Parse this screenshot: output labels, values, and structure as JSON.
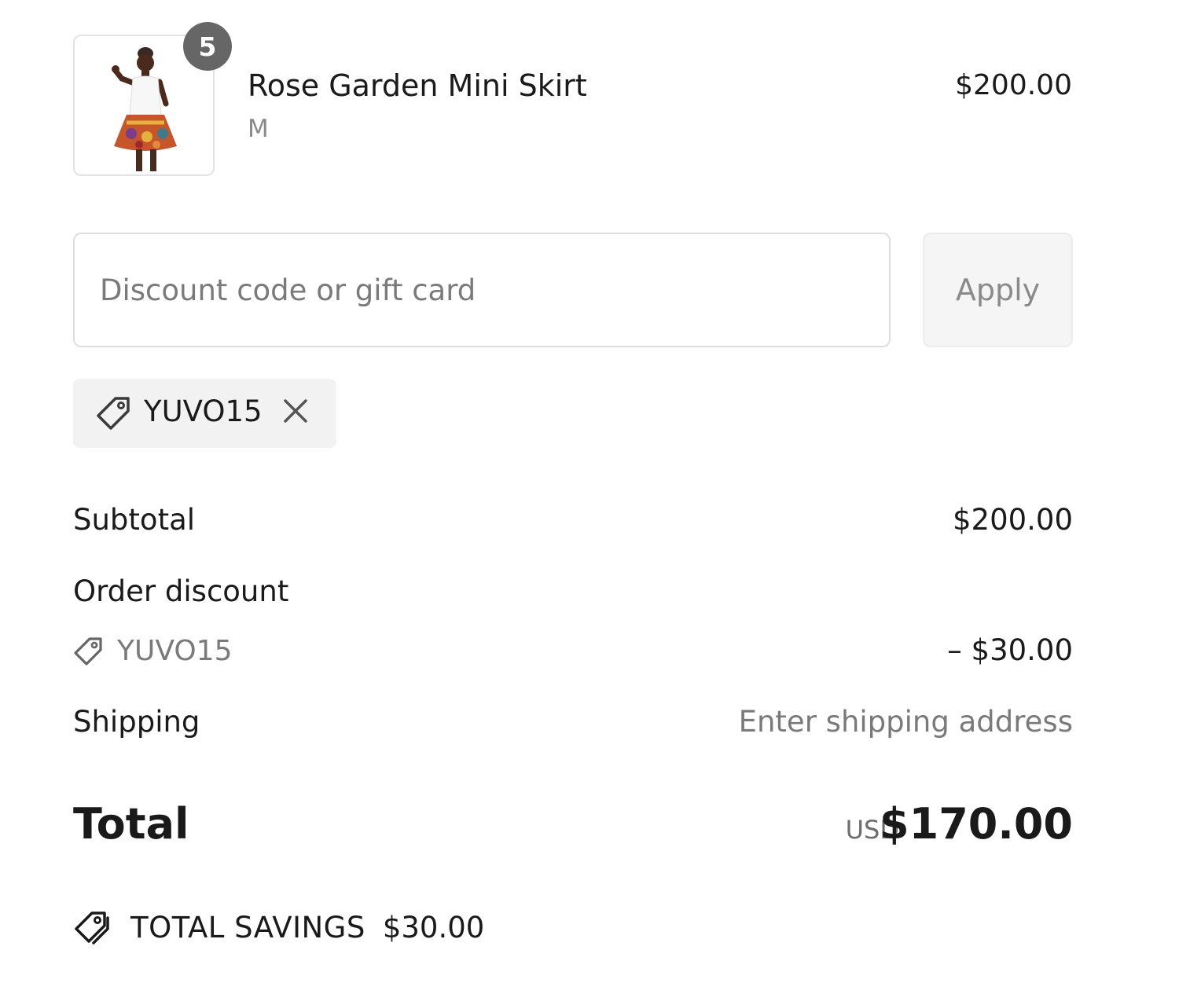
{
  "product": {
    "title": "Rose Garden Mini Skirt",
    "variant": "M",
    "price": "$200.00",
    "quantity": "5",
    "image_icon": "product-photo"
  },
  "discount": {
    "placeholder": "Discount code or gift card",
    "value": "",
    "apply_label": "Apply",
    "applied_code": "YUVO15"
  },
  "summary": {
    "subtotal_label": "Subtotal",
    "subtotal_value": "$200.00",
    "order_discount_label": "Order discount",
    "order_discount_code": "YUVO15",
    "order_discount_value": "– $30.00",
    "shipping_label": "Shipping",
    "shipping_value": "Enter shipping address"
  },
  "total": {
    "label": "Total",
    "currency": "USD",
    "amount": "$170.00"
  },
  "savings": {
    "label": "TOTAL SAVINGS",
    "amount": "$30.00"
  },
  "colors": {
    "text": "#1a1a1a",
    "muted": "#7a7a7a",
    "badge": "#666666",
    "chip_bg": "#f2f2f2",
    "border": "#dedede"
  }
}
